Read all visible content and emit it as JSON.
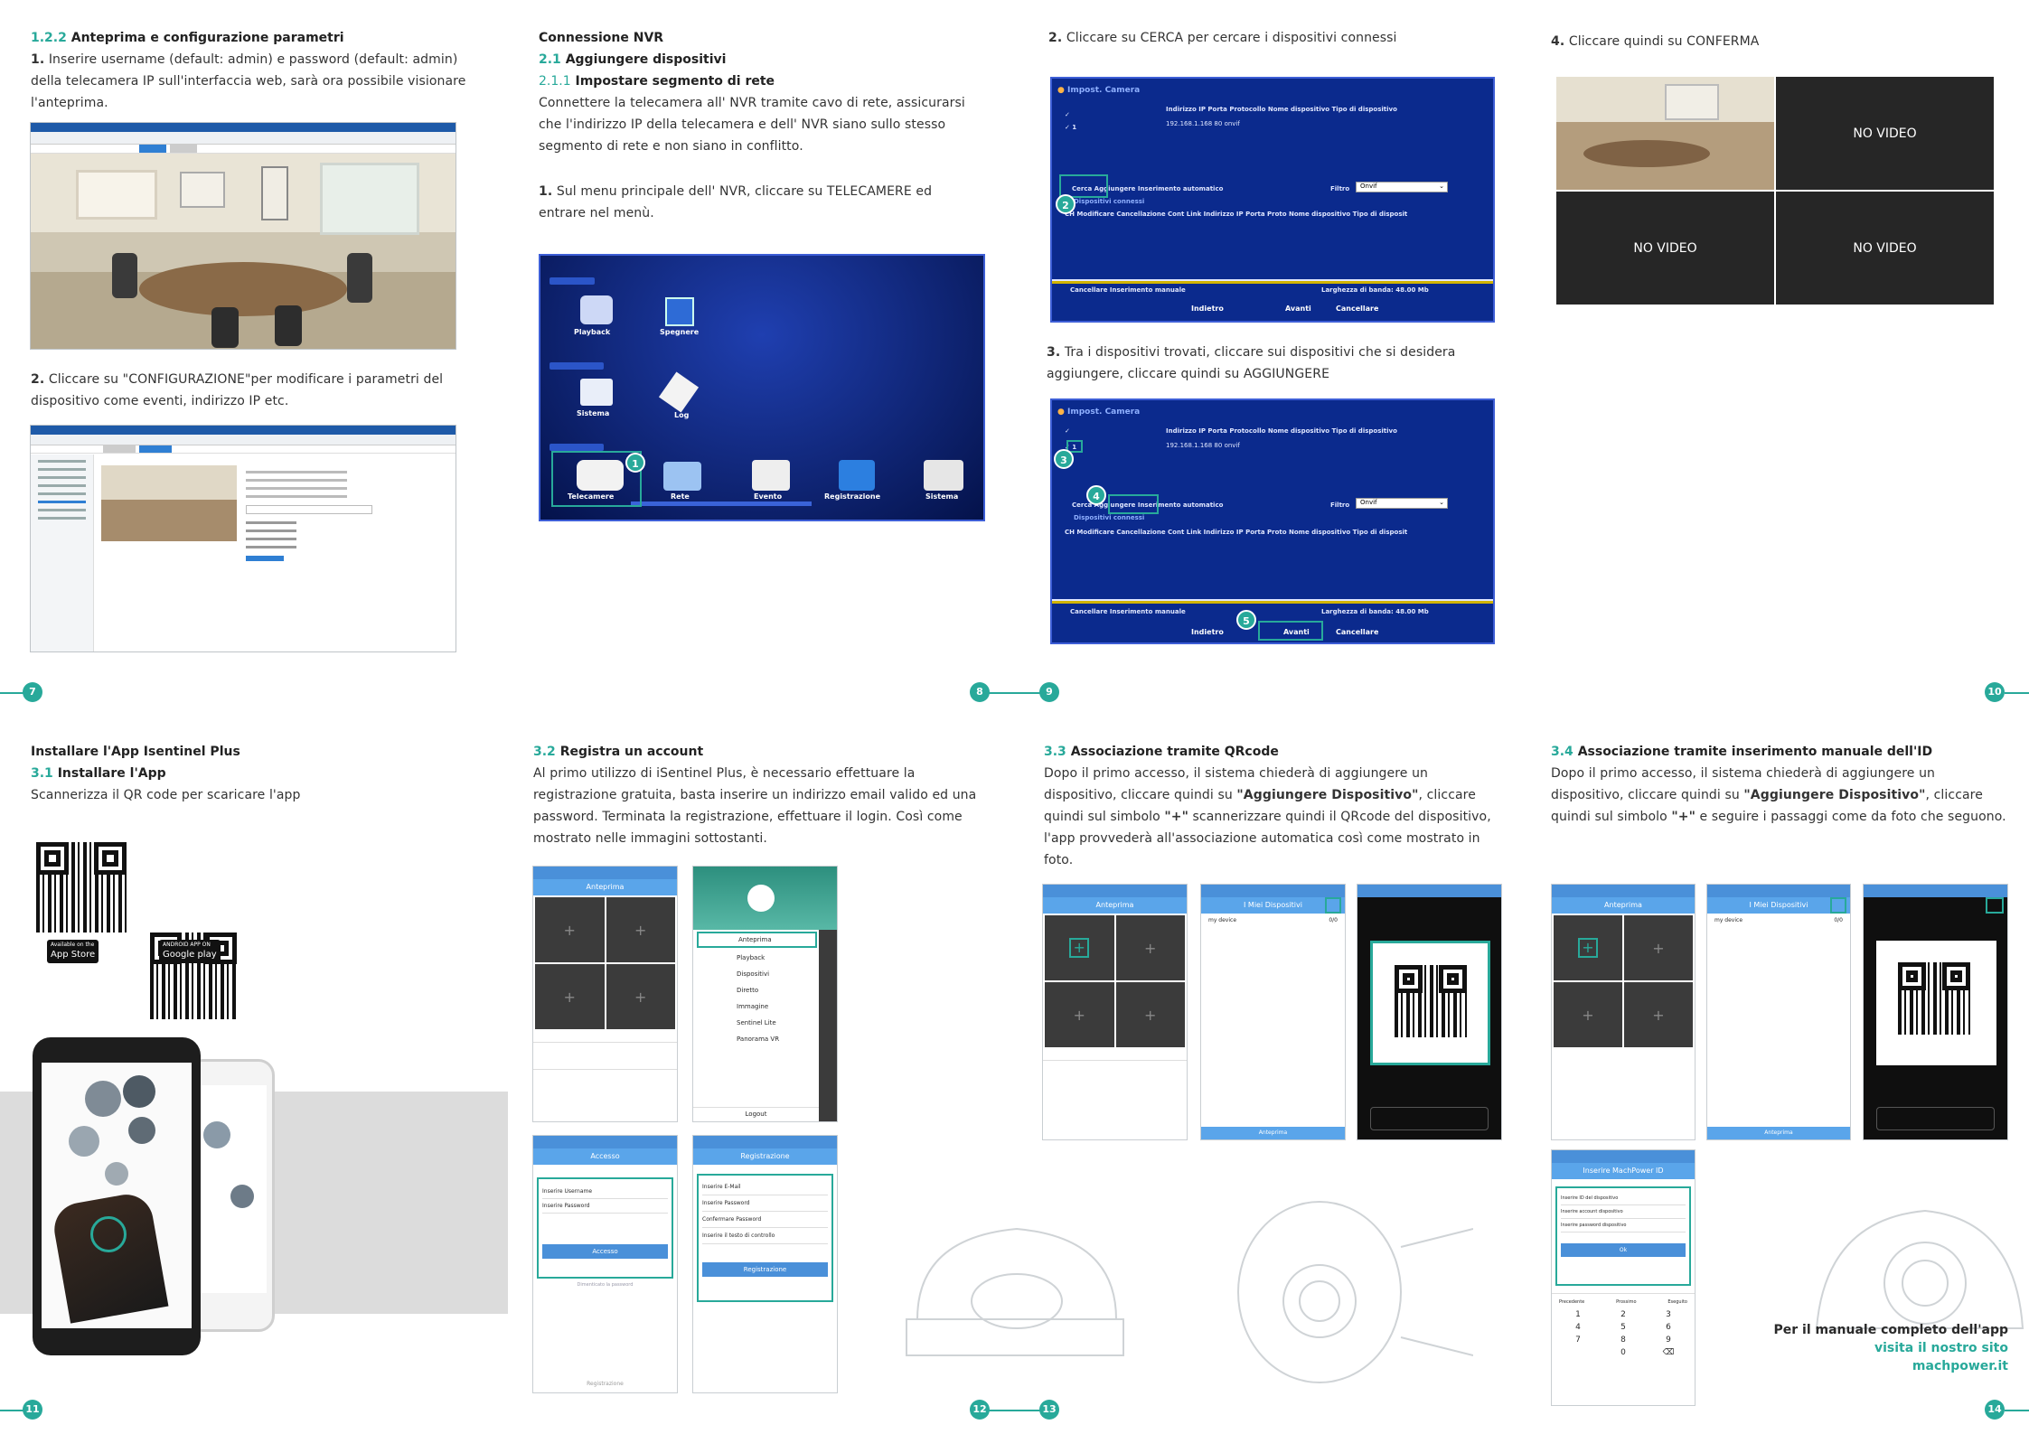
{
  "col1": {
    "section_num": "1.2.2",
    "section_title": "Anteprima e configurazione parametri",
    "step1_num": "1.",
    "step1_text": "Inserire username (default: admin) e password (default: admin) della telecamera IP sull'interfaccia web, sarà ora possibile visionare l'anteprima.",
    "step2_num": "2.",
    "step2_text": "Cliccare su \"CONFIGURAZIONE\"per modificare i parametri del dispositivo come eventi, indirizzo IP etc.",
    "page": "7"
  },
  "col2": {
    "title": "Connessione NVR",
    "sub_num": "2.1",
    "sub_title": "Aggiungere dispositivi",
    "subsub_num": "2.1.1",
    "subsub_title": "Impostare segmento di rete",
    "intro": "Connettere la telecamera all' NVR tramite cavo di rete, assicurarsi che l'indirizzo IP della telecamera e dell' NVR siano sullo stesso segmento di rete e non siano in conflitto.",
    "step1_num": "1.",
    "step1_text": "Sul menu principale dell' NVR, cliccare su TELECAMERE ed entrare nel menù.",
    "menu": [
      "Playback",
      "Spegnere",
      "Sistema",
      "Log",
      "Telecamere",
      "Rete",
      "Evento",
      "Registrazione",
      "Sistema"
    ],
    "marker": "1",
    "page": "8"
  },
  "col3": {
    "step2_num": "2.",
    "step2_text": "Cliccare su CERCA per cercare i dispositivi connessi",
    "step3_num": "3.",
    "step3_text": "Tra i dispositivi trovati, cliccare sui dispositivi che si desidera aggiungere, cliccare quindi su AGGIUNGERE",
    "nvr_header": "Impost. Camera",
    "nvr_cols": "Indirizzo IP   Porta   Protocollo   Nome dispositivo   Tipo di dispositivo",
    "nvr_row": "192.168.1.168        80        onvif",
    "nvr_buttons": "Cerca     Aggiungere     Inserimento automatico",
    "nvr_filter": "Filtro",
    "nvr_filter_val": "Onvif",
    "nvr_connected": "Dispositivi connessi",
    "nvr_cols2": "CH  Modificare  Cancellazione  Cont  Link   Indirizzo IP   Porta  Proto  Nome dispositivo  Tipo di disposit",
    "nvr_footer": "Cancellare    Inserimento manuale",
    "nvr_band": "Larghezza di banda:  48.00 Mb",
    "nvr_nav": [
      "Indietro",
      "Avanti",
      "Cancellare"
    ],
    "markers": [
      "2",
      "3",
      "4",
      "5"
    ],
    "page": "9"
  },
  "col4": {
    "step4_num": "4.",
    "step4_text": "Cliccare quindi su CONFERMA",
    "novideo": "NO VIDEO",
    "page": "10"
  },
  "col5": {
    "title": "Installare l'App Isentinel Plus",
    "sub_num": "3.1",
    "sub_title": "Installare l'App",
    "text": "Scannerizza il QR code per scaricare l'app",
    "appstore": "App Store",
    "appstore_small": "Available on the",
    "googleplay": "Google play",
    "googleplay_small": "ANDROID APP ON",
    "page": "11"
  },
  "col6": {
    "sub_num": "3.2",
    "sub_title": "Registra un account",
    "text": "Al primo utilizzo di iSentinel Plus, è necessario effettuare la registrazione gratuita, basta inserire un indirizzo email valido ed una password. Terminata la registrazione, effettuare il login. Così come mostrato nelle immagini sottostanti.",
    "phone1_title": "Anteprima",
    "menu_items": [
      "Anteprima",
      "Playback",
      "Dispositivi",
      "Diretto",
      "Immagine",
      "Sentinel Lite",
      "Panorama VR"
    ],
    "logout": "Logout",
    "login_title": "Accesso",
    "login_user": "Inserire Username",
    "login_pass": "Inserire Password",
    "login_btn": "Accesso",
    "login_forgot": "Dimenticato la password",
    "login_register": "Registrazione",
    "reg_title": "Registrazione",
    "reg_email": "Inserire E-Mail",
    "reg_pass": "Inserire Password",
    "reg_confirm": "Confermare Password",
    "reg_code": "Inserire il testo di controllo",
    "reg_btn": "Registrazione",
    "page": "12"
  },
  "col7": {
    "sub_num": "3.3",
    "sub_title": "Associazione tramite QRcode",
    "text_a": "Dopo il primo accesso, il sistema chiederà di aggiungere un dispositivo, cliccare quindi su ",
    "text_b": "\"Aggiungere Dispositivo\"",
    "text_c": ", cliccare quindi sul simbolo ",
    "text_d": "\"+\"",
    "text_e": " scannerizzare quindi il QRcode del dispositivo, l'app provvederà all'associazione automatica così come mostrato in foto.",
    "phone1_title": "Anteprima",
    "phone2_title": "I Miei Dispositivi",
    "phone2_item": "my device",
    "phone2_count": "0/0",
    "phone2_btn": "Anteprima",
    "page": "13"
  },
  "col8": {
    "sub_num": "3.4",
    "sub_title": "Associazione tramite inserimento manuale dell'ID",
    "text_a": "Dopo il primo accesso, il sistema chiederà di aggiungere un dispositivo, cliccare quindi su ",
    "text_b": "\"Aggiungere Dispositivo\"",
    "text_c": ", cliccare quindi sul simbolo ",
    "text_d": "\"+\"",
    "text_e": " e seguire i passaggi come da foto che seguono.",
    "manual_title": "Inserire MachPower ID",
    "manual_fields": [
      "Inserire ID del dispositivo",
      "Inserire account dispositivo",
      "Inserire password dispositivo"
    ],
    "manual_btn": "Ok",
    "keypad_header": [
      "Precedente",
      "Prossimo",
      "Eseguito"
    ],
    "keypad": [
      "1",
      "2",
      "3",
      "4",
      "5",
      "6",
      "7",
      "8",
      "9",
      "",
      "0",
      "⌫"
    ],
    "footer_line1": "Per il manuale completo dell'app",
    "footer_line2": "visita il nostro sito",
    "footer_line3": "machpower.it",
    "page": "14"
  },
  "colors": {
    "accent": "#28a99a",
    "nvr_blue": "#0b2a8d",
    "phone_blue": "#5aa5ea"
  }
}
